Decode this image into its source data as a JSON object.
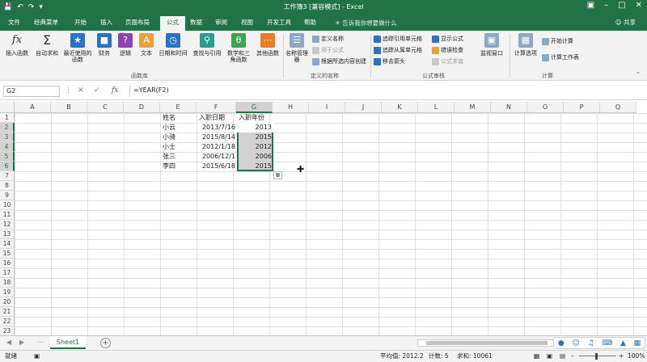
{
  "window": {
    "title": "工作簿3 [兼容模式] - Excel",
    "share_label": "共享",
    "tell_me": "告诉我你想要做什么"
  },
  "tabs": [
    "文件",
    "经典菜单",
    "开始",
    "插入",
    "页面布局",
    "公式",
    "数据",
    "审阅",
    "视图",
    "开发工具",
    "帮助"
  ],
  "active_tab": "公式",
  "ribbon": {
    "insert_function": "插入函数",
    "autosum": "自动求和",
    "recent": "最近使用的函数",
    "financial": "财务",
    "logical": "逻辑",
    "text": "文本",
    "datetime": "日期和时间",
    "lookup": "查找与引用",
    "math": "数学和三角函数",
    "more": "其他函数",
    "group_library": "函数库",
    "name_manager": "名称管理器",
    "define_name": "定义名称",
    "use_in_formula": "用于公式",
    "create_from_selection": "根据所选内容创建",
    "group_names": "定义的名称",
    "trace_precedents": "追踪引用单元格",
    "trace_dependents": "追踪从属单元格",
    "remove_arrows": "移去箭头",
    "show_formulas": "显示公式",
    "error_checking": "错误检查",
    "evaluate_formula": "公式求值",
    "group_audit": "公式审核",
    "watch_window": "监视窗口",
    "calc_options": "计算选项",
    "calc_now": "开始计算",
    "calc_sheet": "计算工作表",
    "group_calc": "计算"
  },
  "formula_bar": {
    "name_box": "G2",
    "fx": "fx",
    "formula": "=YEAR(F2)"
  },
  "columns": [
    "A",
    "B",
    "C",
    "D",
    "E",
    "F",
    "G",
    "H",
    "I",
    "J",
    "K",
    "L",
    "M",
    "N",
    "O",
    "P",
    "Q"
  ],
  "selected_column": "G",
  "rows": [
    "1",
    "2",
    "3",
    "4",
    "5",
    "6",
    "7",
    "8",
    "9",
    "10",
    "11",
    "12",
    "13",
    "14",
    "15",
    "16",
    "17",
    "18",
    "19",
    "20",
    "21",
    "22",
    "23"
  ],
  "cells": {
    "E1": "姓名",
    "F1": "入职日期",
    "G1": "入职年份",
    "E2": "小云",
    "F2": "2013/7/16",
    "G2": "2013",
    "E3": "小骑",
    "F3": "2015/8/14",
    "G3": "2015",
    "E4": "小士",
    "F4": "2012/1/18",
    "G4": "2012",
    "E5": "张三",
    "F5": "2006/12/1",
    "G5": "2006",
    "E6": "李四",
    "F6": "2015/6/18",
    "G6": "2015"
  },
  "sheet_tab": "Sheet1",
  "status": {
    "ready": "就绪",
    "average": "平均值: 2012.2",
    "count": "计数: 5",
    "sum": "求和: 10061",
    "zoom": "100%"
  },
  "colors": {
    "excel_green": "#217346",
    "ribbon_bg": "#f3f3f3"
  }
}
